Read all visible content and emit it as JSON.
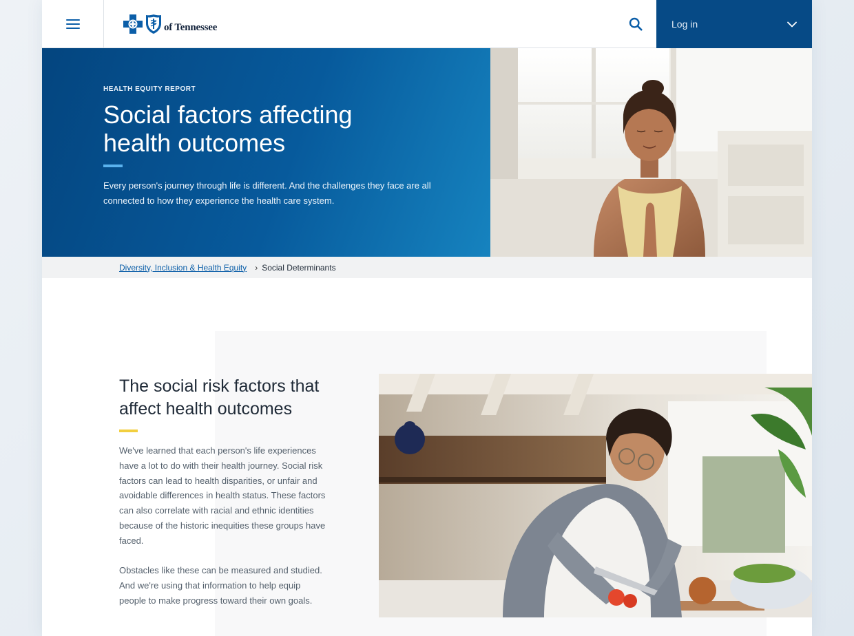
{
  "header": {
    "menu_icon": "hamburger-icon",
    "logo_text": "of Tennessee",
    "search_icon": "search-icon",
    "login_label": "Log in",
    "login_chevron": "chevron-down-icon",
    "brand_color": "#064a86"
  },
  "hero": {
    "eyebrow": "HEALTH EQUITY REPORT",
    "title": "Social factors affecting health outcomes",
    "description": "Every person's journey through life is different. And the challenges they face are all connected to how they experience the health care system.",
    "accent_color": "#5ab2ee"
  },
  "breadcrumb": {
    "link": "Diversity, Inclusion & Health Equity",
    "current": "Social Determinants"
  },
  "section": {
    "title": "The social risk factors that affect health outcomes",
    "accent_color": "#f2cf3f",
    "paragraph1": "We've learned that each person's life experiences have a lot to do with their health journey. Social risk factors can lead to health disparities, or unfair and avoidable differences in health status. These factors can also correlate with racial and ethnic identities because of the historic inequities these groups have faced.",
    "paragraph2": "Obstacles like these can be measured and studied. And we're using that information to help equip people to make progress toward their own goals."
  }
}
